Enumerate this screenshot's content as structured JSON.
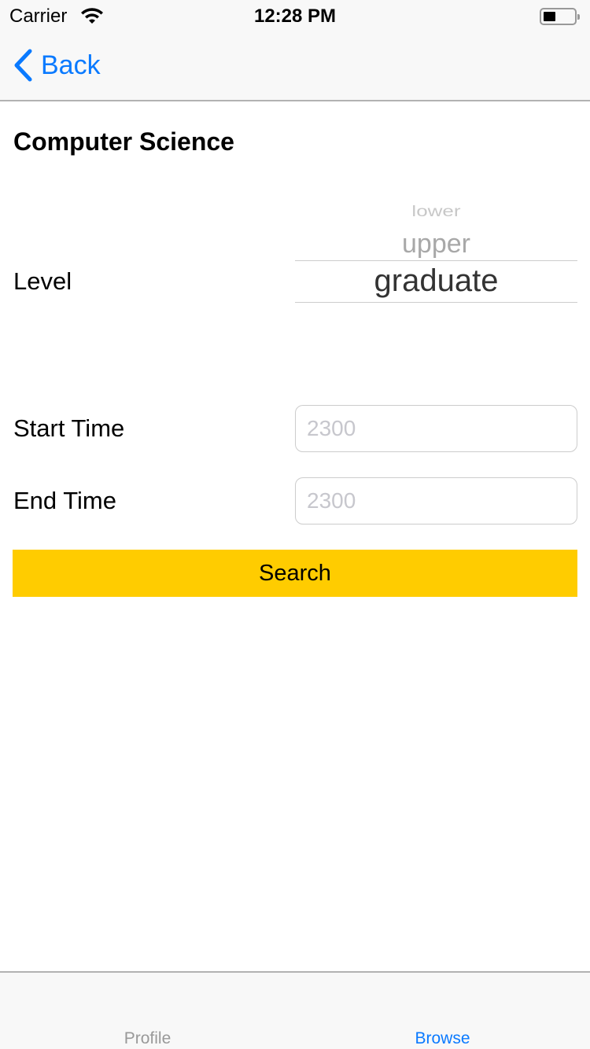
{
  "status_bar": {
    "carrier": "Carrier",
    "time": "12:28 PM"
  },
  "nav": {
    "back_label": "Back"
  },
  "page": {
    "title": "Computer Science"
  },
  "level": {
    "label": "Level",
    "options": [
      "lower",
      "upper",
      "graduate"
    ],
    "selected": "graduate"
  },
  "start_time": {
    "label": "Start Time",
    "placeholder": "2300",
    "value": ""
  },
  "end_time": {
    "label": "End Time",
    "placeholder": "2300",
    "value": ""
  },
  "search_label": "Search",
  "tabs": [
    {
      "label": "Profile",
      "active": false
    },
    {
      "label": "Browse",
      "active": true
    }
  ],
  "colors": {
    "accent": "#0a7aff",
    "button": "#ffcc00",
    "inactive_tab": "#999999"
  }
}
